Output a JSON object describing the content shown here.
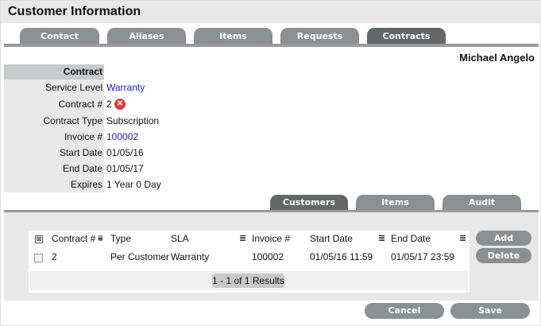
{
  "title": "Customer Information",
  "tabs": [
    "Contact",
    "Aliases",
    "Items",
    "Requests",
    "Contracts"
  ],
  "customer_name": "Michael Angelo",
  "contract": {
    "header": "Contract",
    "fields": [
      {
        "label": "Service Level",
        "value": "Warranty"
      },
      {
        "label": "Contract #",
        "value": "2"
      },
      {
        "label": "Contract Type",
        "value": "Subscription"
      },
      {
        "label": "Invoice #",
        "value": "100002"
      },
      {
        "label": "Start Date",
        "value": "01/05/16"
      },
      {
        "label": "End Date",
        "value": "01/05/17"
      },
      {
        "label": "Expires",
        "value": "1 Year 0 Day"
      }
    ]
  },
  "subtabs": [
    "Customers",
    "Items",
    "Audit"
  ],
  "table": {
    "columns": [
      "Contract #",
      "Type",
      "SLA",
      "Invoice #",
      "Start Date",
      "End Date"
    ],
    "rows": [
      [
        "2",
        "Per Customer",
        "Warranty",
        "100002",
        "01/05/16 11:59",
        "01/05/17 23:59"
      ]
    ],
    "results": "1 - 1 of 1 Results"
  },
  "buttons": {
    "add": "Add",
    "delete": "Delete",
    "cancel": "Cancel",
    "save": "Save"
  }
}
